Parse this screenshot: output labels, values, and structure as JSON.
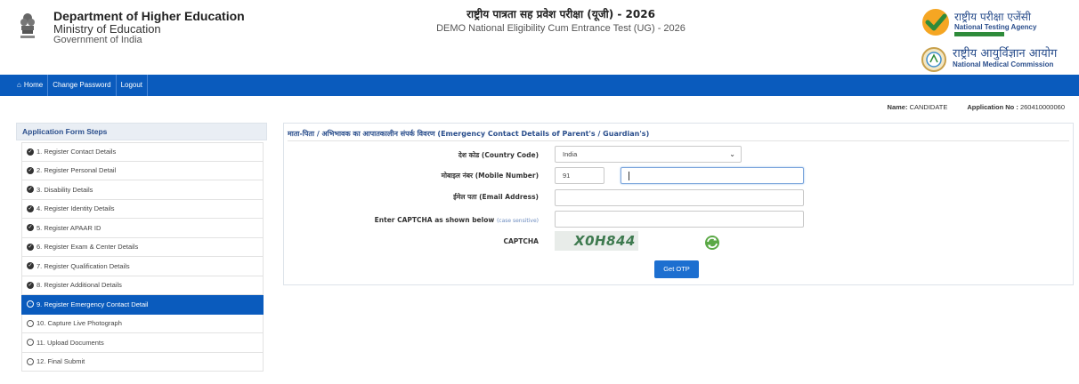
{
  "header": {
    "dept_line1": "Department of Higher Education",
    "dept_line2": "Ministry of Education",
    "dept_line3": "Government of India",
    "title_hindi": "राष्ट्रीय पात्रता सह प्रवेश परीक्षा (यूजी) - 2026",
    "subtitle": "DEMO National Eligibility Cum Entrance Test (UG) - 2026",
    "nta_hindi": "राष्ट्रीय परीक्षा एजेंसी",
    "nta_english": "National Testing Agency",
    "nmc_hindi": "राष्ट्रीय आयुर्विज्ञान आयोग",
    "nmc_english": "National Medical Commission"
  },
  "nav": {
    "home": "Home",
    "change_password": "Change Password",
    "logout": "Logout"
  },
  "user": {
    "name_label": "Name:",
    "name_value": "CANDIDATE",
    "app_label": "Application No :",
    "app_value": "260410000060"
  },
  "sidebar": {
    "title": "Application Form Steps",
    "steps": [
      {
        "label": "1. Register Contact Details",
        "status": "done"
      },
      {
        "label": "2. Register Personal Detail",
        "status": "done"
      },
      {
        "label": "3. Disability Details",
        "status": "done"
      },
      {
        "label": "4. Register Identity Details",
        "status": "done"
      },
      {
        "label": "5. Register APAAR ID",
        "status": "done"
      },
      {
        "label": "6. Register Exam & Center Details",
        "status": "done"
      },
      {
        "label": "7. Register Qualification Details",
        "status": "done"
      },
      {
        "label": "8. Register Additional Details",
        "status": "done"
      },
      {
        "label": "9. Register Emergency Contact Detail",
        "status": "active"
      },
      {
        "label": "10. Capture Live Photograph",
        "status": "pending"
      },
      {
        "label": "11. Upload Documents",
        "status": "pending"
      },
      {
        "label": "12. Final Submit",
        "status": "pending"
      }
    ]
  },
  "form": {
    "title": "माता-पिता / अभिभावक का आपातकालीन संपर्क विवरण (Emergency Contact Details of Parent's / Guardian's)",
    "country_label": "देश कोड (Country Code)",
    "country_value": "India",
    "mobile_label": "मोबाइल नंबर (Mobile Number)",
    "mobile_code": "91",
    "mobile_value": "",
    "email_label": "ईमेल पता (Email Address)",
    "email_value": "",
    "captcha_label": "Enter CAPTCHA as shown below",
    "captcha_note": "(case sensitive)",
    "captcha_value": "",
    "captcha_title": "CAPTCHA",
    "captcha_text": "X0H844",
    "otp_button": "Get OTP"
  },
  "colors": {
    "nav_bg": "#0a5bbd",
    "accent": "#2a4e8c",
    "button": "#1d6fd0"
  }
}
